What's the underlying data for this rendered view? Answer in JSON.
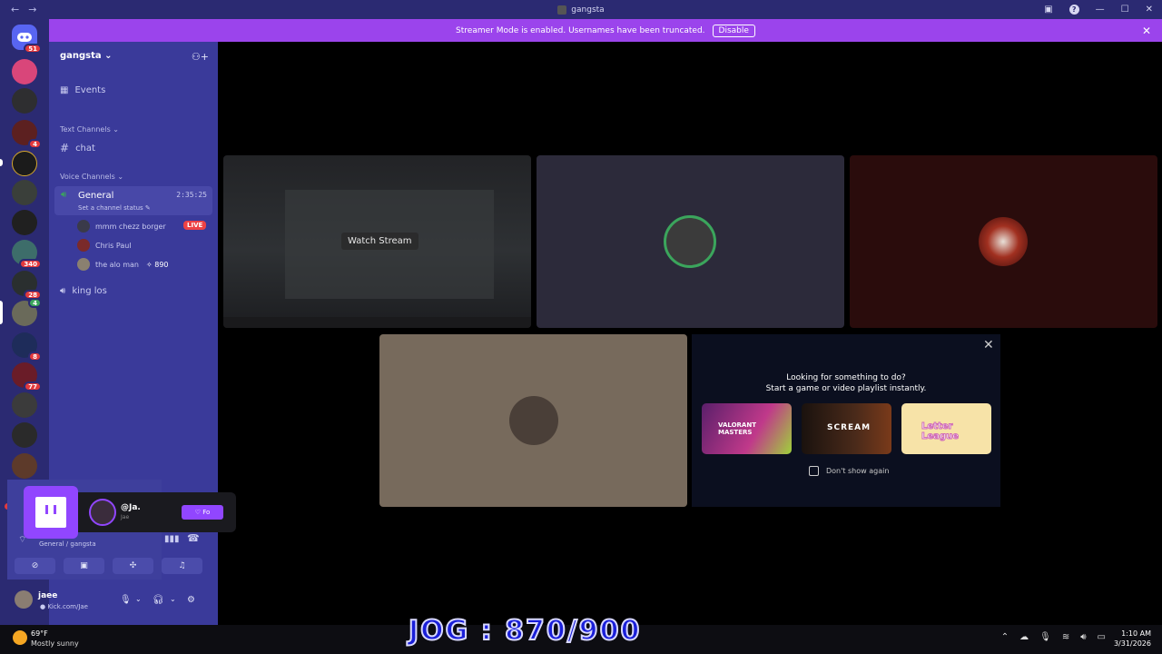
{
  "window": {
    "title": "gangsta",
    "nav_back": "←",
    "nav_fwd": "→"
  },
  "banner": {
    "text": "Streamer Mode is enabled. Usernames have been truncated.",
    "button": "Disable"
  },
  "rail_badges": [
    "51",
    "4",
    "340",
    "28",
    "4",
    "8",
    "77",
    "NE"
  ],
  "sidebar": {
    "guild": "gangsta",
    "events": "Events",
    "text_category": "Text Channels",
    "text_channel": "chat",
    "voice_category": "Voice Channels",
    "voice_channel": "General",
    "voice_time": "2:35:25",
    "voice_status": "Set a channel status",
    "voice_users": [
      {
        "name": "mmm chezz borger"
      },
      {
        "name": "Chris Paul"
      },
      {
        "name": "the alo man",
        "points": "890"
      }
    ],
    "live_badge": "LIVE",
    "other_voice": "king los"
  },
  "voice_panel": {
    "state": "nnected",
    "location": "General / gangsta"
  },
  "user": {
    "name": "jaee",
    "status": "Kick.com/Jae"
  },
  "twitch": {
    "handle": "@Ja.",
    "sub": "Jae",
    "follow": "Fo"
  },
  "call": {
    "watch_stream": "Watch Stream"
  },
  "activity": {
    "title": "Looking for something to do?",
    "subtitle": "Start a game or video playlist instantly.",
    "checkbox": "Don't show again",
    "games": [
      {
        "name": "VALORANT MASTERS",
        "color": "#7a2a8a"
      },
      {
        "name": "SCREAM",
        "color": "#1a120e"
      },
      {
        "name": "Letter League",
        "color": "#f3d28a"
      }
    ]
  },
  "taskbar": {
    "temp": "69°F",
    "weather": "Mostly sunny",
    "overlay": "JOG : 870/900",
    "time": "1:10 AM",
    "date": "3/31/2026"
  },
  "colors": {
    "brand": "#5865f2",
    "streamer_banner": "#9b44ec",
    "live": "#ed4245",
    "twitch": "#9146ff"
  }
}
